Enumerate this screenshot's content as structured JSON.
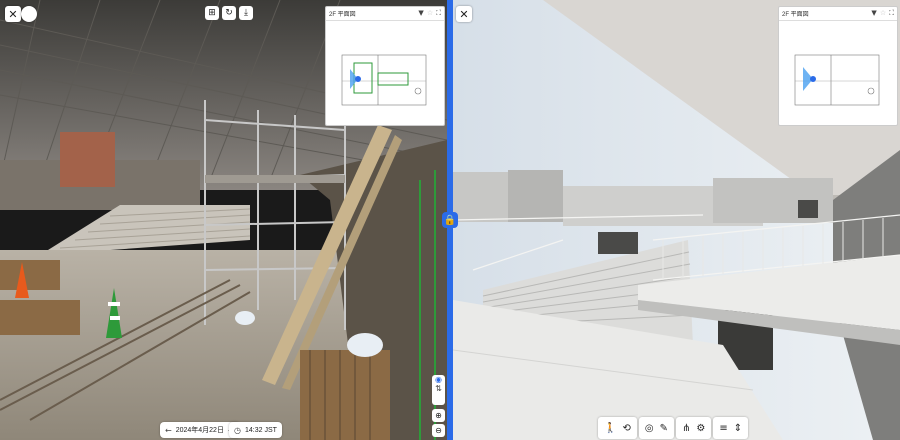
{
  "left_view": {
    "minimap": {
      "title": "2F 平面図"
    },
    "date": {
      "label": "2024年4月22日"
    },
    "time": {
      "label": "14:32 JST"
    }
  },
  "right_view": {
    "minimap": {
      "title": "2F 平面図"
    }
  },
  "colors": {
    "accent": "#2b6be8",
    "scaffold": "#b8b8b8",
    "cone": "#e85a1c",
    "rebar_green": "#2e9a3a"
  },
  "icons": {
    "close": "✕",
    "add": "+",
    "rotate": "↻",
    "download": "⤓",
    "dropdown": "▼",
    "fullscreen": "⛶",
    "prev": "←",
    "next": "→",
    "zoom_in": "+",
    "zoom_out": "−",
    "person": "👤",
    "measure": "✎",
    "layers": "≡",
    "settings": "⚙"
  }
}
